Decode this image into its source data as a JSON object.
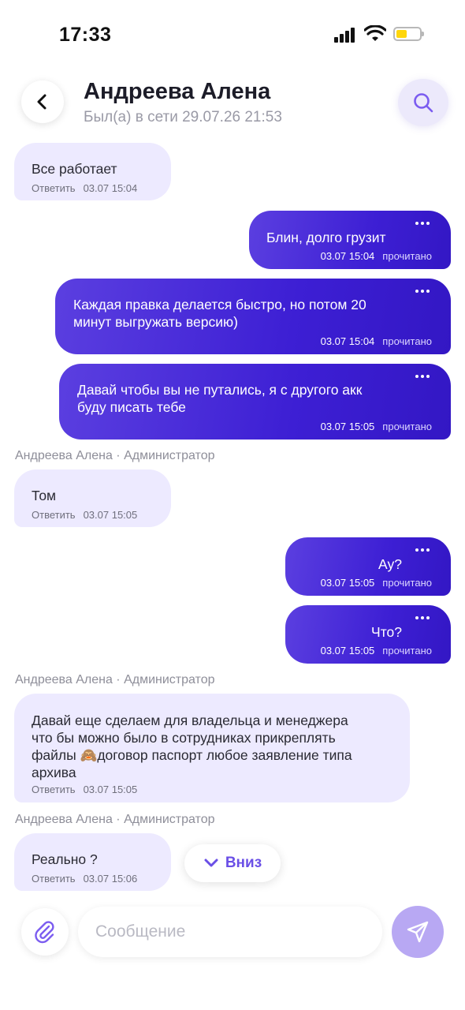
{
  "status_bar": {
    "time": "17:33",
    "battery_color": "#ffd60a"
  },
  "header": {
    "title": "Андреева Алена",
    "status": "Был(а) в сети 29.07.26 21:53",
    "back_icon": "chevron-left-icon",
    "search_icon": "search-icon"
  },
  "colors": {
    "accent": "#5b3fe0",
    "incoming_bubble": "#edeaff",
    "outgoing_bubble": "#3d1fd4"
  },
  "messages": [
    {
      "dir": "in",
      "text": "Все работает",
      "reply": "Ответить",
      "time": "03.07 15:04"
    },
    {
      "dir": "out",
      "text": "Блин, долго грузит",
      "time": "03.07 15:04",
      "status": "прочитано"
    },
    {
      "dir": "out",
      "text_lines": [
        "Каждая правка делается быстро, но потом 20",
        "минут выгружать версию)"
      ],
      "time": "03.07 15:04",
      "status": "прочитано"
    },
    {
      "dir": "out",
      "text_lines": [
        "Давай чтобы вы не путались, я с другого акк",
        "буду писать тебе"
      ],
      "time": "03.07 15:05",
      "status": "прочитано"
    },
    {
      "dir": "in",
      "sender": "Андреева Алена · Администратор",
      "text": "Том",
      "reply": "Ответить",
      "time": "03.07 15:05"
    },
    {
      "dir": "out",
      "text": "Ау?",
      "time": "03.07 15:05",
      "status": "прочитано"
    },
    {
      "dir": "out",
      "text": "Что?",
      "time": "03.07 15:05",
      "status": "прочитано"
    },
    {
      "dir": "in",
      "sender": "Андреева Алена · Администратор",
      "text_lines": [
        "Давай еще сделаем для владельца и менеджера",
        "что бы можно было в сотрудниках прикреплять",
        "файлы 🙈договор паспорт любое заявление типа",
        "архива"
      ],
      "reply": "Ответить",
      "time": "03.07 15:05"
    },
    {
      "dir": "in",
      "sender": "Андреева Алена · Администратор",
      "text": "Реально ?",
      "reply": "Ответить",
      "time": "03.07 15:06"
    }
  ],
  "scroll_down": {
    "label": "Вниз",
    "icon": "chevron-down-icon"
  },
  "composer": {
    "placeholder": "Сообщение",
    "value": "",
    "attach_icon": "paperclip-icon",
    "send_icon": "send-icon"
  }
}
